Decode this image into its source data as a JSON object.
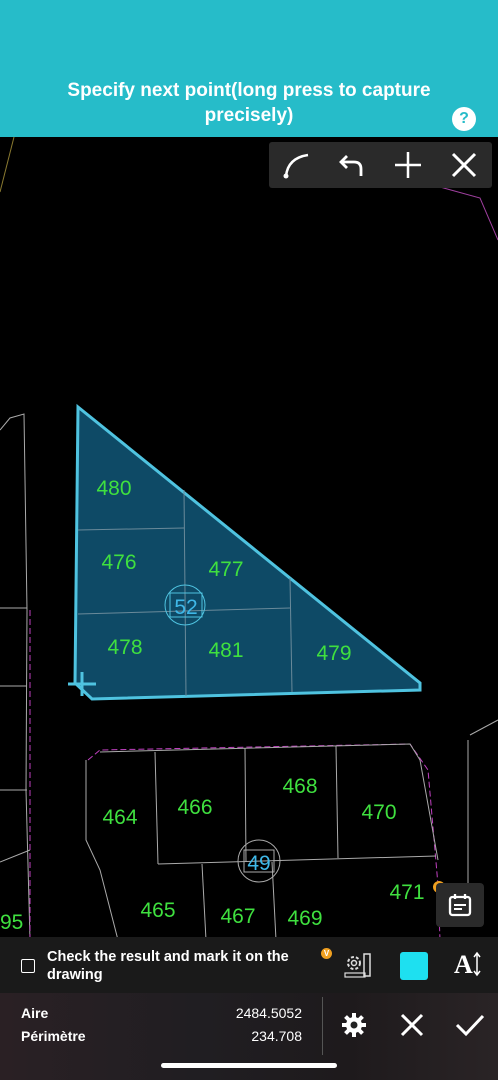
{
  "header": {
    "title": "Specify next point(long press to capture precisely)",
    "help_label": "?"
  },
  "toolbar": {
    "tools": [
      "arc-icon",
      "undo-icon",
      "plus-icon",
      "close-icon"
    ]
  },
  "drawing": {
    "parcel_labels": [
      "480",
      "476",
      "477",
      "478",
      "481",
      "479"
    ],
    "parcel_id": "52",
    "lot_labels": [
      "464",
      "466",
      "468",
      "470",
      "465",
      "467",
      "469",
      "471"
    ],
    "block_id": "49",
    "edge_label": "95",
    "colors": {
      "highlight_fill": "#0e4a66",
      "highlight_stroke": "#4fc3e0",
      "label_green": "#3fe03f",
      "label_blue": "#3fb8e8",
      "boundary_magenta": "#c040c0"
    }
  },
  "panel": {
    "check_text": "Check the result and mark it on the drawing",
    "badge": "V",
    "font_button": "A",
    "swatch_color": "#1ee0f0",
    "stats": [
      {
        "label": "Aire",
        "value": "2484.5052"
      },
      {
        "label": "Périmètre",
        "value": "234.708"
      }
    ]
  }
}
